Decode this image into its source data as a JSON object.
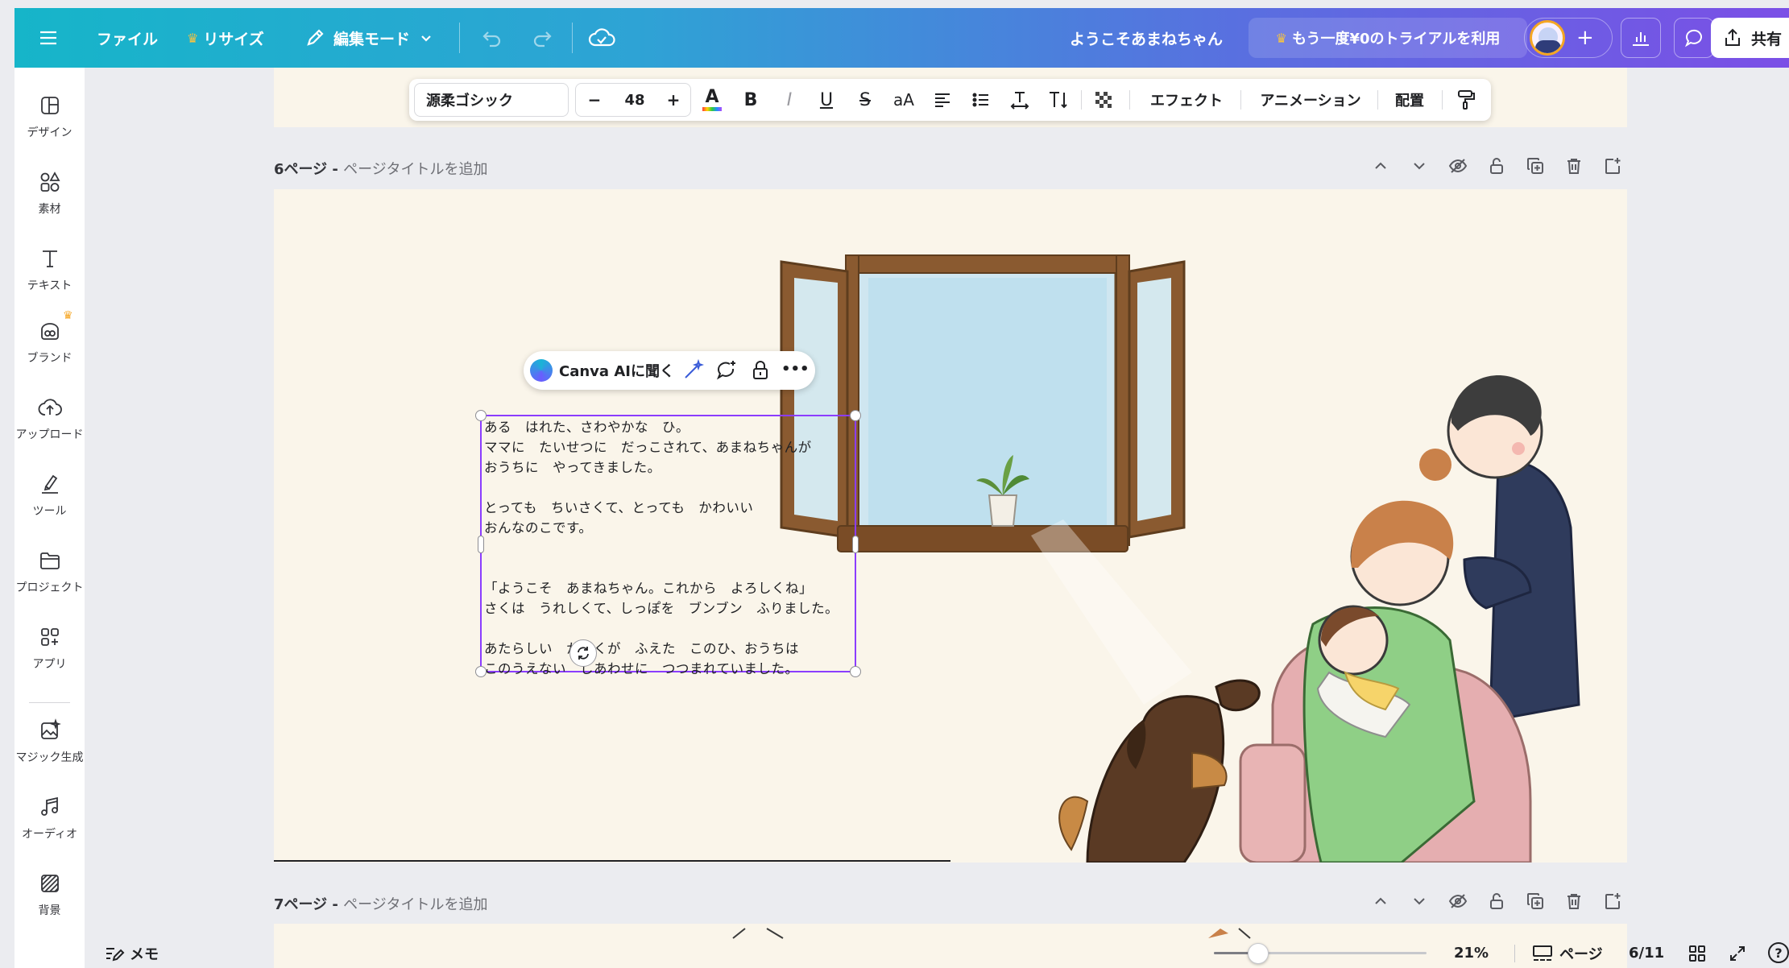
{
  "topbar": {
    "file_label": "ファイル",
    "resize_label": "リサイズ",
    "mode_label": "編集モード",
    "welcome_text": "ようこそあまねちゃん",
    "trial_label": "もう一度¥0のトライアルを利用",
    "share_label": "共有",
    "plus_label": "+"
  },
  "sidebar": {
    "items": [
      {
        "label": "デザイン"
      },
      {
        "label": "素材"
      },
      {
        "label": "テキスト"
      },
      {
        "label": "ブランド"
      },
      {
        "label": "アップロード"
      },
      {
        "label": "ツール"
      },
      {
        "label": "プロジェクト"
      },
      {
        "label": "アプリ"
      },
      {
        "label": "マジック生成"
      },
      {
        "label": "オーディオ"
      },
      {
        "label": "背景"
      }
    ]
  },
  "format_toolbar": {
    "font_name": "源柔ゴシック",
    "minus": "−",
    "font_size": "48",
    "plus": "+",
    "font_color_letter": "A",
    "bold": "B",
    "italic": "I",
    "underline": "U",
    "strike": "S",
    "case": "aA",
    "effects": "エフェクト",
    "animation": "アニメーション",
    "position": "配置"
  },
  "pages": {
    "page6": {
      "number_label": "6ページ - ",
      "title_placeholder": "ページタイトルを追加"
    },
    "page7": {
      "number_label": "7ページ - ",
      "title_placeholder": "ページタイトルを追加"
    }
  },
  "context_menu": {
    "ai_label": "Canva AIに聞く",
    "more": "•••"
  },
  "story_text": {
    "lines": [
      "ある　はれた、さわやかな　ひ。",
      "ママに　たいせつに　だっこされて、あまねちゃんが",
      "おうちに　やってきました。",
      "とっても　ちいさくて、とっても　かわいい",
      "おんなのこです。",
      "「ようこそ　あまねちゃん。これから　よろしくね」",
      "さくは　うれしくて、しっぽを　ブンブン　ふりました。",
      "あたらしい　かぞくが　ふえた　このひ、おうちは",
      "このうえない　しあわせに　つつまれていました。"
    ]
  },
  "bottombar": {
    "notes_label": "メモ",
    "zoom_value": 0.21,
    "zoom_label": "21%",
    "pages_label": "ページ",
    "page_counter": "6/11",
    "help": "?"
  },
  "colors": {
    "accent": "#8b3dff",
    "topbar_start": "#16b5c9",
    "topbar_end": "#7b4fe6",
    "page_bg": "#faf5ea"
  }
}
